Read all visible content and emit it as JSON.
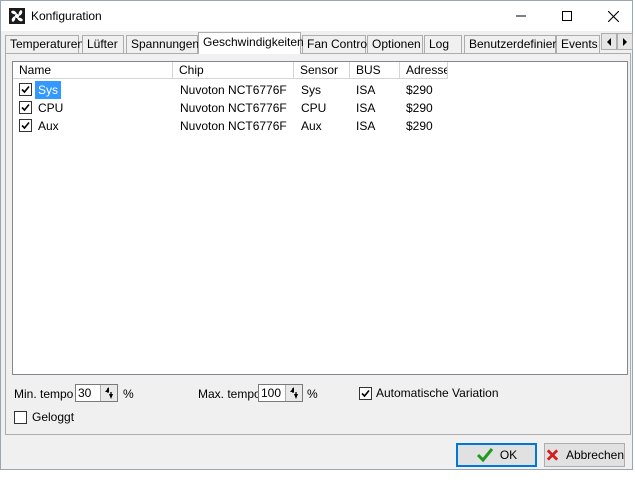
{
  "window": {
    "title": "Konfiguration"
  },
  "tabs": [
    {
      "label": "Temperaturen"
    },
    {
      "label": "Lüfter"
    },
    {
      "label": "Spannungen"
    },
    {
      "label": "Geschwindigkeiten",
      "active": true
    },
    {
      "label": "Fan Control"
    },
    {
      "label": "Optionen"
    },
    {
      "label": "Log"
    },
    {
      "label": "Benutzerdefiniert"
    },
    {
      "label": "Events"
    }
  ],
  "list": {
    "columns": [
      "Name",
      "Chip",
      "Sensor",
      "BUS",
      "Adresse"
    ],
    "rows": [
      {
        "checked": true,
        "name": "Sys",
        "chip": "Nuvoton NCT6776F",
        "sensor": "Sys",
        "bus": "ISA",
        "address": "$290",
        "selected": true
      },
      {
        "checked": true,
        "name": "CPU",
        "chip": "Nuvoton NCT6776F",
        "sensor": "CPU",
        "bus": "ISA",
        "address": "$290"
      },
      {
        "checked": true,
        "name": "Aux",
        "chip": "Nuvoton NCT6776F",
        "sensor": "Aux",
        "bus": "ISA",
        "address": "$290"
      }
    ]
  },
  "settings": {
    "min_tempo_label": "Min. tempo",
    "min_tempo_value": "30",
    "max_tempo_label": "Max. tempo",
    "max_tempo_value": "100",
    "percent": "%",
    "auto_variation_label": "Automatische Variation",
    "auto_variation_checked": true,
    "logged_label": "Geloggt",
    "logged_checked": false
  },
  "buttons": {
    "ok": "OK",
    "cancel": "Abbrechen"
  },
  "colors": {
    "selection": "#3399ff",
    "ok_check": "#1e9a1e",
    "cancel_x": "#d22020",
    "default_border": "#0078d7"
  },
  "icons": [
    "app-fan-icon",
    "minimize-icon",
    "maximize-icon",
    "close-icon",
    "tab-scroll-left-icon",
    "tab-scroll-right-icon",
    "checkmark-icon",
    "cross-icon",
    "spin-arrows-icon"
  ]
}
